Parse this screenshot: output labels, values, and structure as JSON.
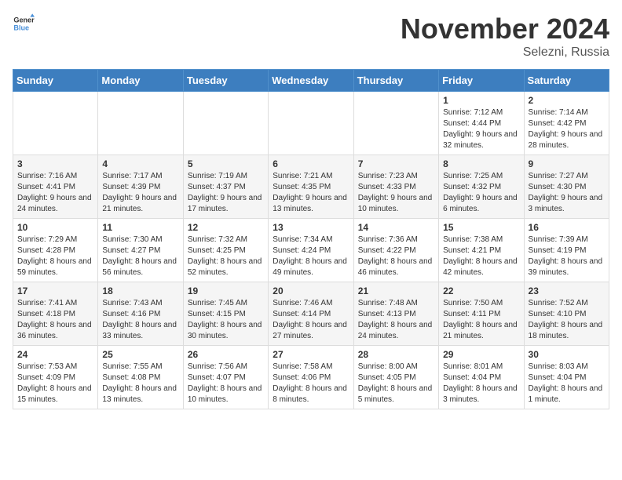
{
  "header": {
    "logo_general": "General",
    "logo_blue": "Blue",
    "month_title": "November 2024",
    "subtitle": "Selezni, Russia"
  },
  "days_of_week": [
    "Sunday",
    "Monday",
    "Tuesday",
    "Wednesday",
    "Thursday",
    "Friday",
    "Saturday"
  ],
  "weeks": [
    [
      {
        "day": "",
        "info": ""
      },
      {
        "day": "",
        "info": ""
      },
      {
        "day": "",
        "info": ""
      },
      {
        "day": "",
        "info": ""
      },
      {
        "day": "",
        "info": ""
      },
      {
        "day": "1",
        "info": "Sunrise: 7:12 AM\nSunset: 4:44 PM\nDaylight: 9 hours and 32 minutes."
      },
      {
        "day": "2",
        "info": "Sunrise: 7:14 AM\nSunset: 4:42 PM\nDaylight: 9 hours and 28 minutes."
      }
    ],
    [
      {
        "day": "3",
        "info": "Sunrise: 7:16 AM\nSunset: 4:41 PM\nDaylight: 9 hours and 24 minutes."
      },
      {
        "day": "4",
        "info": "Sunrise: 7:17 AM\nSunset: 4:39 PM\nDaylight: 9 hours and 21 minutes."
      },
      {
        "day": "5",
        "info": "Sunrise: 7:19 AM\nSunset: 4:37 PM\nDaylight: 9 hours and 17 minutes."
      },
      {
        "day": "6",
        "info": "Sunrise: 7:21 AM\nSunset: 4:35 PM\nDaylight: 9 hours and 13 minutes."
      },
      {
        "day": "7",
        "info": "Sunrise: 7:23 AM\nSunset: 4:33 PM\nDaylight: 9 hours and 10 minutes."
      },
      {
        "day": "8",
        "info": "Sunrise: 7:25 AM\nSunset: 4:32 PM\nDaylight: 9 hours and 6 minutes."
      },
      {
        "day": "9",
        "info": "Sunrise: 7:27 AM\nSunset: 4:30 PM\nDaylight: 9 hours and 3 minutes."
      }
    ],
    [
      {
        "day": "10",
        "info": "Sunrise: 7:29 AM\nSunset: 4:28 PM\nDaylight: 8 hours and 59 minutes."
      },
      {
        "day": "11",
        "info": "Sunrise: 7:30 AM\nSunset: 4:27 PM\nDaylight: 8 hours and 56 minutes."
      },
      {
        "day": "12",
        "info": "Sunrise: 7:32 AM\nSunset: 4:25 PM\nDaylight: 8 hours and 52 minutes."
      },
      {
        "day": "13",
        "info": "Sunrise: 7:34 AM\nSunset: 4:24 PM\nDaylight: 8 hours and 49 minutes."
      },
      {
        "day": "14",
        "info": "Sunrise: 7:36 AM\nSunset: 4:22 PM\nDaylight: 8 hours and 46 minutes."
      },
      {
        "day": "15",
        "info": "Sunrise: 7:38 AM\nSunset: 4:21 PM\nDaylight: 8 hours and 42 minutes."
      },
      {
        "day": "16",
        "info": "Sunrise: 7:39 AM\nSunset: 4:19 PM\nDaylight: 8 hours and 39 minutes."
      }
    ],
    [
      {
        "day": "17",
        "info": "Sunrise: 7:41 AM\nSunset: 4:18 PM\nDaylight: 8 hours and 36 minutes."
      },
      {
        "day": "18",
        "info": "Sunrise: 7:43 AM\nSunset: 4:16 PM\nDaylight: 8 hours and 33 minutes."
      },
      {
        "day": "19",
        "info": "Sunrise: 7:45 AM\nSunset: 4:15 PM\nDaylight: 8 hours and 30 minutes."
      },
      {
        "day": "20",
        "info": "Sunrise: 7:46 AM\nSunset: 4:14 PM\nDaylight: 8 hours and 27 minutes."
      },
      {
        "day": "21",
        "info": "Sunrise: 7:48 AM\nSunset: 4:13 PM\nDaylight: 8 hours and 24 minutes."
      },
      {
        "day": "22",
        "info": "Sunrise: 7:50 AM\nSunset: 4:11 PM\nDaylight: 8 hours and 21 minutes."
      },
      {
        "day": "23",
        "info": "Sunrise: 7:52 AM\nSunset: 4:10 PM\nDaylight: 8 hours and 18 minutes."
      }
    ],
    [
      {
        "day": "24",
        "info": "Sunrise: 7:53 AM\nSunset: 4:09 PM\nDaylight: 8 hours and 15 minutes."
      },
      {
        "day": "25",
        "info": "Sunrise: 7:55 AM\nSunset: 4:08 PM\nDaylight: 8 hours and 13 minutes."
      },
      {
        "day": "26",
        "info": "Sunrise: 7:56 AM\nSunset: 4:07 PM\nDaylight: 8 hours and 10 minutes."
      },
      {
        "day": "27",
        "info": "Sunrise: 7:58 AM\nSunset: 4:06 PM\nDaylight: 8 hours and 8 minutes."
      },
      {
        "day": "28",
        "info": "Sunrise: 8:00 AM\nSunset: 4:05 PM\nDaylight: 8 hours and 5 minutes."
      },
      {
        "day": "29",
        "info": "Sunrise: 8:01 AM\nSunset: 4:04 PM\nDaylight: 8 hours and 3 minutes."
      },
      {
        "day": "30",
        "info": "Sunrise: 8:03 AM\nSunset: 4:04 PM\nDaylight: 8 hours and 1 minute."
      }
    ]
  ]
}
